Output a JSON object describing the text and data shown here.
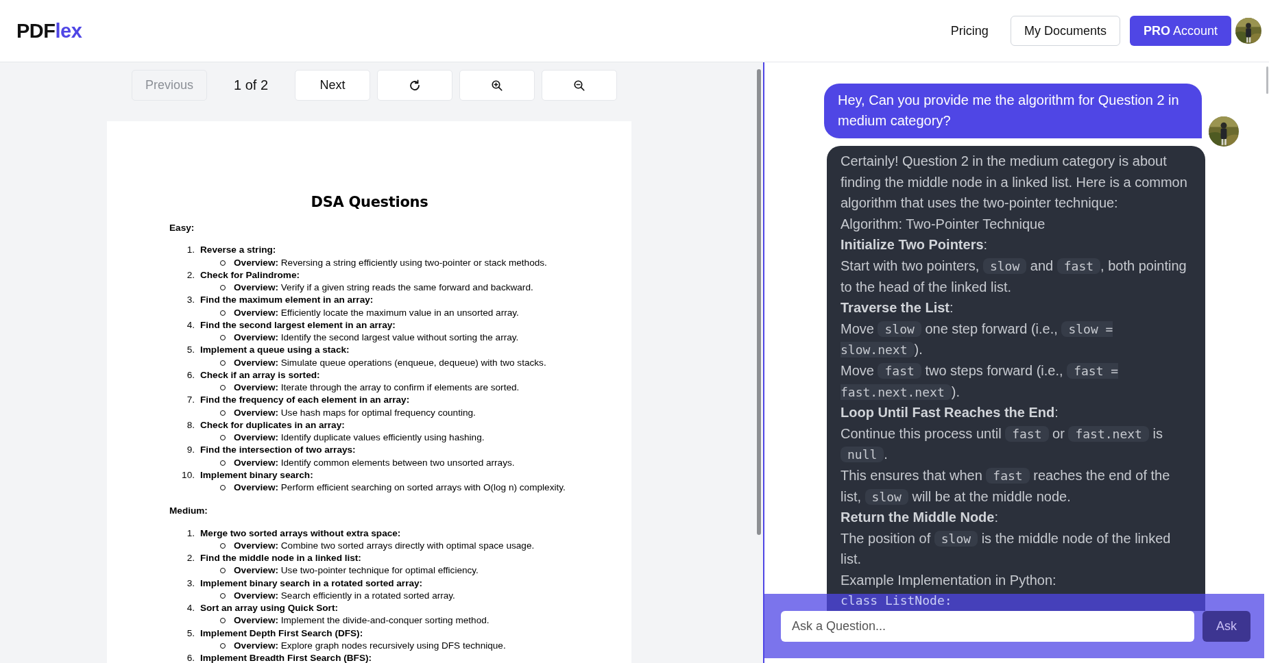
{
  "header": {
    "logo": {
      "prefix": "PDF",
      "suffix": "lex"
    },
    "nav": [
      {
        "label": "Pricing",
        "kind": "link"
      },
      {
        "label": "My Documents",
        "kind": "outline"
      },
      {
        "label": "**PRO** Account",
        "kind": "primary"
      }
    ]
  },
  "toolbar": {
    "previous": {
      "label": "Previous",
      "disabled": true
    },
    "page_indicator": "1 of 2",
    "next": {
      "label": "Next",
      "disabled": false
    }
  },
  "document": {
    "title": "DSA Questions",
    "sections": [
      {
        "heading": "Easy:",
        "items": [
          {
            "number": "1.",
            "title": "Reverse a string:",
            "overview": "**Overview:** Reversing a string efficiently using two-pointer or stack methods."
          },
          {
            "number": "2.",
            "title": "Check for Palindrome:",
            "overview": "**Overview:** Verify if a given string reads the same forward and backward."
          },
          {
            "number": "3.",
            "title": "Find the maximum element in an array:",
            "overview": "**Overview:** Efficiently locate the maximum value in an unsorted array."
          },
          {
            "number": "4.",
            "title": "Find the second largest element in an array:",
            "overview": "**Overview:** Identify the second largest value without sorting the array."
          },
          {
            "number": "5.",
            "title": "Implement a queue using a stack:",
            "overview": "**Overview:** Simulate queue operations (enqueue, dequeue) with two stacks."
          },
          {
            "number": "6.",
            "title": "Check if an array is sorted:",
            "overview": "**Overview:** Iterate through the array to confirm if elements are sorted."
          },
          {
            "number": "7.",
            "title": "Find the frequency of each element in an array:",
            "overview": "**Overview:** Use hash maps for optimal frequency counting."
          },
          {
            "number": "8.",
            "title": "Check for duplicates in an array:",
            "overview": "**Overview:** Identify duplicate values efficiently using hashing."
          },
          {
            "number": "9.",
            "title": "Find the intersection of two arrays:",
            "overview": "**Overview:** Identify common elements between two unsorted arrays."
          },
          {
            "number": "10.",
            "title": "Implement binary search:",
            "overview": "**Overview:** Perform efficient searching on sorted arrays with O(log n) complexity."
          }
        ]
      },
      {
        "heading": "Medium:",
        "items": [
          {
            "number": "1.",
            "title": "Merge two sorted arrays without extra space:",
            "overview": "**Overview:** Combine two sorted arrays directly with optimal space usage."
          },
          {
            "number": "2.",
            "title": "Find the middle node in a linked list:",
            "overview": "**Overview:** Use two-pointer technique for optimal efficiency."
          },
          {
            "number": "3.",
            "title": "Implement binary search in a rotated sorted array:",
            "overview": "**Overview:** Search efficiently in a rotated sorted array."
          },
          {
            "number": "4.",
            "title": "Sort an array using Quick Sort:",
            "overview": "**Overview:** Implement the divide-and-conquer sorting method."
          },
          {
            "number": "5.",
            "title": "Implement Depth First Search (DFS):",
            "overview": "**Overview:** Explore graph nodes recursively using DFS technique."
          },
          {
            "number": "6.",
            "title": "Implement Breadth First Search (BFS):"
          }
        ]
      }
    ]
  },
  "chat": {
    "messages": [
      {
        "kind": "user",
        "text": "Hey, Can you provide me the algorithm for Question 2 in medium category?"
      },
      {
        "kind": "assistant",
        "paragraphs": [
          [
            {
              "kind": "text",
              "text": "Certainly! Question 2 in the medium category is about finding the middle node in a linked list. Here is a common algorithm that uses the two-pointer technique:"
            }
          ],
          [
            {
              "kind": "text",
              "text": "Algorithm: Two-Pointer Technique"
            }
          ],
          [
            {
              "kind": "bold",
              "text": "Initialize Two Pointers"
            },
            {
              "kind": "text",
              "text": ":"
            }
          ],
          [
            {
              "kind": "text",
              "text": "Start with two pointers, "
            },
            {
              "kind": "code",
              "text": "slow"
            },
            {
              "kind": "text",
              "text": " and "
            },
            {
              "kind": "code",
              "text": "fast"
            },
            {
              "kind": "text",
              "text": ", both pointing to the head of the linked list."
            }
          ],
          [
            {
              "kind": "bold",
              "text": "Traverse the List"
            },
            {
              "kind": "text",
              "text": ":"
            }
          ],
          [
            {
              "kind": "text",
              "text": "Move "
            },
            {
              "kind": "code",
              "text": "slow"
            },
            {
              "kind": "text",
              "text": " one step forward (i.e., "
            },
            {
              "kind": "code",
              "text": "slow = slow.next"
            },
            {
              "kind": "text",
              "text": ")."
            }
          ],
          [
            {
              "kind": "text",
              "text": "Move "
            },
            {
              "kind": "code",
              "text": "fast"
            },
            {
              "kind": "text",
              "text": " two steps forward (i.e., "
            },
            {
              "kind": "code",
              "text": "fast = fast.next.next"
            },
            {
              "kind": "text",
              "text": ")."
            }
          ],
          [
            {
              "kind": "bold",
              "text": "Loop Until Fast Reaches the End"
            },
            {
              "kind": "text",
              "text": ":"
            }
          ],
          [
            {
              "kind": "text",
              "text": "Continue this process until "
            },
            {
              "kind": "code",
              "text": "fast"
            },
            {
              "kind": "text",
              "text": " or "
            },
            {
              "kind": "code",
              "text": "fast.next"
            },
            {
              "kind": "text",
              "text": " is "
            },
            {
              "kind": "code",
              "text": "null"
            },
            {
              "kind": "text",
              "text": "."
            }
          ],
          [
            {
              "kind": "text",
              "text": "This ensures that when "
            },
            {
              "kind": "code",
              "text": "fast"
            },
            {
              "kind": "text",
              "text": " reaches the end of the list, "
            },
            {
              "kind": "code",
              "text": "slow"
            },
            {
              "kind": "text",
              "text": " will be at the middle node."
            }
          ],
          [
            {
              "kind": "bold",
              "text": "Return the Middle Node"
            },
            {
              "kind": "text",
              "text": ":"
            }
          ],
          [
            {
              "kind": "text",
              "text": "The position of "
            },
            {
              "kind": "code",
              "text": "slow"
            },
            {
              "kind": "text",
              "text": " is the middle node of the linked list."
            }
          ],
          [
            {
              "kind": "text",
              "text": "Example Implementation in Python:"
            }
          ]
        ],
        "code": [
          "class ListNode:"
        ]
      }
    ],
    "input": {
      "placeholder": "Ask a Question...",
      "button": "Ask"
    }
  }
}
